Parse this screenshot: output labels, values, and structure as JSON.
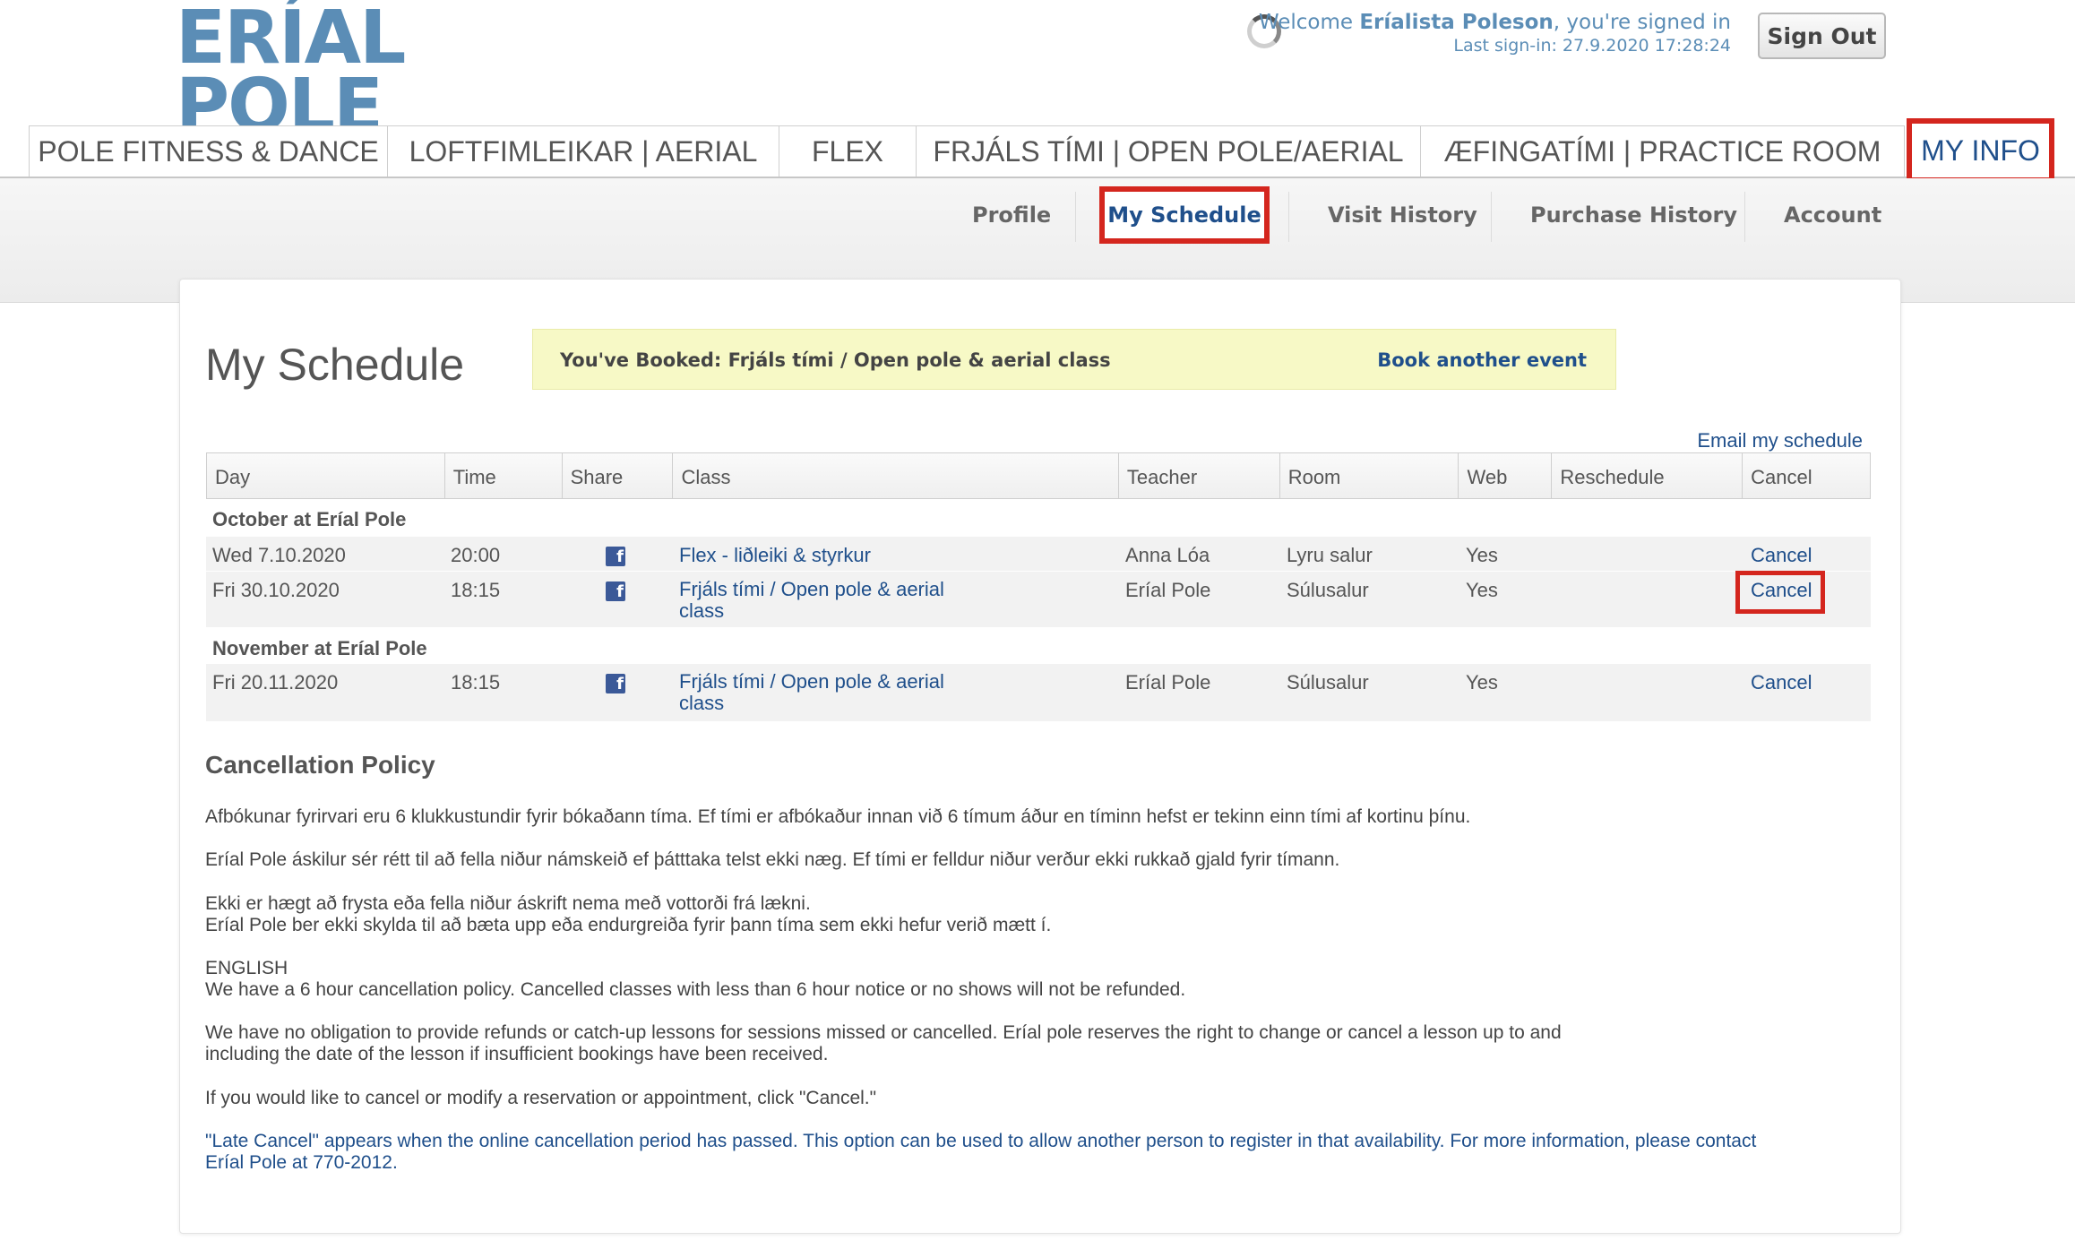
{
  "logo": {
    "line1": "ERÍAL",
    "line2": "POLE"
  },
  "header": {
    "welcome_prefix": "Welcome",
    "user_name": "Eríalista Poleson",
    "welcome_suffix": ", you're signed in",
    "last_signin": "Last sign-in: 27.9.2020 17:28:24",
    "sign_out": "Sign Out"
  },
  "tabs": [
    "POLE FITNESS & DANCE",
    "LOFTFIMLEIKAR | AERIAL",
    "FLEX",
    "FRJÁLS TÍMI | OPEN POLE/AERIAL",
    "ÆFINGATÍMI | PRACTICE ROOM",
    "MY INFO"
  ],
  "subnav": [
    "Profile",
    "My Schedule",
    "Visit History",
    "Purchase History",
    "Account"
  ],
  "page_title": "My Schedule",
  "notice": {
    "text": "You've Booked: Frjáls tími / Open pole & aerial class",
    "link": "Book another event"
  },
  "email_link": "Email my schedule",
  "table": {
    "headers": [
      "Day",
      "Time",
      "Share",
      "Class",
      "Teacher",
      "Room",
      "Web",
      "Reschedule",
      "Cancel"
    ],
    "groups": [
      {
        "title": "October at Eríal Pole",
        "rows": [
          {
            "day": "Wed 7.10.2020",
            "time": "20:00",
            "class_line1": "Flex - liðleiki & styrkur",
            "class_line2": "",
            "teacher": "Anna Lóa",
            "room": "Lyru salur",
            "web": "Yes",
            "cancel": "Cancel"
          },
          {
            "day": "Fri 30.10.2020",
            "time": "18:15",
            "class_line1": "Frjáls tími / Open pole & aerial",
            "class_line2": "class",
            "teacher": "Eríal Pole",
            "room": "Súlusalur",
            "web": "Yes",
            "cancel": "Cancel"
          }
        ]
      },
      {
        "title": "November at Eríal Pole",
        "rows": [
          {
            "day": "Fri 20.11.2020",
            "time": "18:15",
            "class_line1": "Frjáls tími / Open pole & aerial",
            "class_line2": "class",
            "teacher": "Eríal Pole",
            "room": "Súlusalur",
            "web": "Yes",
            "cancel": "Cancel"
          }
        ]
      }
    ]
  },
  "policy": {
    "title": "Cancellation Policy",
    "p1": "Afbókunar fyrirvari eru 6 klukkustundir fyrir bókaðann tíma. Ef tími er afbókaður innan við 6 tímum áður en tíminn hefst er tekinn einn tími af kortinu þínu.",
    "p2": "Eríal Pole áskilur sér rétt til að fella niður námskeið ef þátttaka telst ekki næg. Ef tími er felldur niður verður ekki rukkað gjald fyrir tímann.",
    "p3a": "Ekki er hægt að frysta eða fella niður áskrift nema með vottorði frá lækni.",
    "p3b": "Eríal Pole ber ekki skylda til að bæta upp eða endurgreiða fyrir þann tíma sem ekki hefur verið mætt í.",
    "p4a": "ENGLISH",
    "p4b": "We have a 6 hour cancellation policy. Cancelled classes with less than 6 hour notice or no shows will not be refunded.",
    "p5a": "We have no obligation to provide refunds or catch-up lessons for sessions missed or cancelled. Eríal pole reserves the right to change or cancel a lesson up to and",
    "p5b": "including the date of the lesson if insufficient bookings have been received.",
    "p6": "If you would like to cancel or modify a reservation or appointment, click \"Cancel.\"",
    "p7a": "\"Late Cancel\" appears when the online cancellation period has passed. This option can be used to allow another person to register in that availability. For more information, please contact",
    "p7b": "Eríal Pole at 770-2012."
  },
  "colors": {
    "brand": "#5b8db6",
    "link": "#1f4f8b",
    "highlight": "#d4261e",
    "notice_bg": "#f7f9c6"
  }
}
